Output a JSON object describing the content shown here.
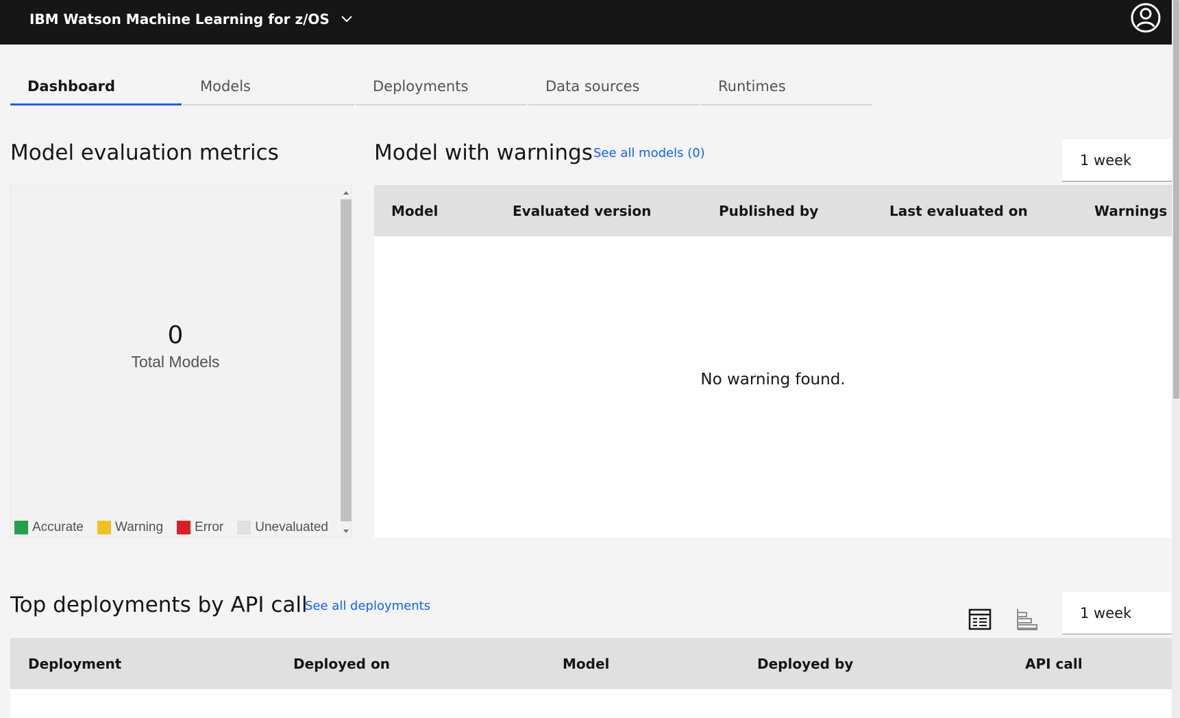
{
  "app": {
    "title": "IBM Watson Machine Learning for z/OS"
  },
  "tabs": [
    {
      "label": "Dashboard",
      "active": true
    },
    {
      "label": "Models"
    },
    {
      "label": "Deployments"
    },
    {
      "label": "Data sources"
    },
    {
      "label": "Runtimes"
    }
  ],
  "metrics": {
    "title": "Model evaluation metrics",
    "total_count": "0",
    "total_label": "Total Models",
    "legend": [
      {
        "label": "Accurate",
        "color": "#24a148"
      },
      {
        "label": "Warning",
        "color": "#f1c21b"
      },
      {
        "label": "Error",
        "color": "#da1e28"
      },
      {
        "label": "Unevaluated",
        "color": "#e0e0e0"
      }
    ]
  },
  "warnings": {
    "title": "Model with warnings",
    "link": "See all models (0)",
    "period": "1 week",
    "columns": [
      "Model",
      "Evaluated version",
      "Published by",
      "Last evaluated on",
      "Warnings"
    ],
    "empty_message": "No warning found."
  },
  "deployments": {
    "title": "Top deployments by API call",
    "link": "See all deployments",
    "period": "1 week",
    "columns": [
      "Deployment",
      "Deployed on",
      "Model",
      "Deployed by",
      "API call"
    ]
  },
  "colors": {
    "topbar": "#161616",
    "accent": "#0f62fe",
    "link": "#0f62fe"
  }
}
